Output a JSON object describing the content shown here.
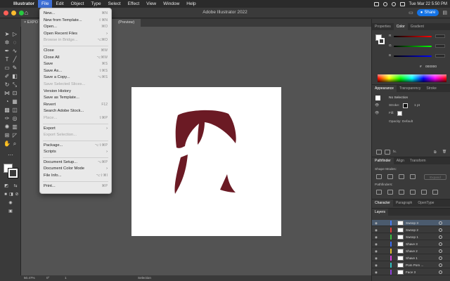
{
  "menubar": {
    "apple": "",
    "items": [
      "Illustrator",
      "File",
      "Edit",
      "Object",
      "Type",
      "Select",
      "Effect",
      "View",
      "Window",
      "Help"
    ],
    "active_index": 1,
    "clock": "Tue Mar 22  5:50 PM"
  },
  "titlebar": {
    "title": "Adobe Illustrator 2022",
    "share_label": "Share",
    "traffic_colors": [
      "#ff5f57",
      "#febc2e",
      "#28c840"
    ]
  },
  "doctab": {
    "label": "EXPO",
    "suffix": "(Preview)"
  },
  "file_menu": {
    "items": [
      {
        "label": "New...",
        "shortcut": "⌘N",
        "disabled": false,
        "submenu": false
      },
      {
        "label": "New from Template...",
        "shortcut": "⇧⌘N",
        "disabled": false,
        "submenu": false
      },
      {
        "label": "Open...",
        "shortcut": "⌘O",
        "disabled": false,
        "submenu": false
      },
      {
        "label": "Open Recent Files",
        "shortcut": "",
        "disabled": false,
        "submenu": true
      },
      {
        "label": "Browse in Bridge...",
        "shortcut": "⌥⌘O",
        "disabled": true,
        "submenu": false
      },
      {
        "sep": true
      },
      {
        "label": "Close",
        "shortcut": "⌘W",
        "disabled": false,
        "submenu": false
      },
      {
        "label": "Close All",
        "shortcut": "⌥⌘W",
        "disabled": false,
        "submenu": false
      },
      {
        "label": "Save",
        "shortcut": "⌘S",
        "disabled": false,
        "submenu": false
      },
      {
        "label": "Save As...",
        "shortcut": "⇧⌘S",
        "disabled": false,
        "submenu": false
      },
      {
        "label": "Save a Copy...",
        "shortcut": "⌥⌘S",
        "disabled": false,
        "submenu": false
      },
      {
        "label": "Save Selected Slices...",
        "shortcut": "",
        "disabled": true,
        "submenu": false
      },
      {
        "label": "Version History",
        "shortcut": "",
        "disabled": false,
        "submenu": false
      },
      {
        "label": "Save as Template...",
        "shortcut": "",
        "disabled": false,
        "submenu": false
      },
      {
        "label": "Revert",
        "shortcut": "F12",
        "disabled": false,
        "submenu": false
      },
      {
        "label": "Search Adobe Stock...",
        "shortcut": "",
        "disabled": false,
        "submenu": false
      },
      {
        "label": "Place...",
        "shortcut": "⇧⌘P",
        "disabled": true,
        "submenu": false
      },
      {
        "sep": true
      },
      {
        "label": "Export",
        "shortcut": "",
        "disabled": false,
        "submenu": true
      },
      {
        "label": "Export Selection...",
        "shortcut": "",
        "disabled": true,
        "submenu": false
      },
      {
        "sep": true
      },
      {
        "label": "Package...",
        "shortcut": "⌥⇧⌘P",
        "disabled": false,
        "submenu": false
      },
      {
        "label": "Scripts",
        "shortcut": "",
        "disabled": false,
        "submenu": true
      },
      {
        "sep": true
      },
      {
        "label": "Document Setup...",
        "shortcut": "⌥⌘P",
        "disabled": false,
        "submenu": false
      },
      {
        "label": "Document Color Mode",
        "shortcut": "",
        "disabled": false,
        "submenu": true
      },
      {
        "label": "File Info...",
        "shortcut": "⌥⇧⌘I",
        "disabled": false,
        "submenu": false
      },
      {
        "sep": true
      },
      {
        "label": "Print...",
        "shortcut": "⌘P",
        "disabled": false,
        "submenu": false
      }
    ]
  },
  "panels": {
    "top_tabs": [
      "Properties",
      "Color",
      "Gradient"
    ],
    "color_labels": {
      "r": "R",
      "g": "G",
      "b": "B"
    },
    "hex_value": "000000",
    "appearance_tabs": [
      "Appearance",
      "Transparency",
      "Stroke"
    ],
    "appearance": {
      "no_selection": "No Selection",
      "stroke_label": "Stroke:",
      "stroke_value": "1 pt",
      "fill_label": "Fill:",
      "opacity_label": "Opacity: Default"
    },
    "pathfinder_tabs": [
      "Pathfinder",
      "Align",
      "Transform"
    ],
    "shape_modes_label": "Shape Modes:",
    "expand_label": "Expand",
    "pathfinders_label": "Pathfinders:",
    "character_tabs": [
      "Character",
      "Paragraph",
      "OpenType"
    ],
    "layers_tab": "Layers",
    "layers": [
      {
        "name": "Swoop 3",
        "color": "#4a7df0",
        "selected": true
      },
      {
        "name": "Swoop 2",
        "color": "#e03c3c",
        "selected": false
      },
      {
        "name": "Swoop 1",
        "color": "#3cc040",
        "selected": false
      },
      {
        "name": "Shave 3",
        "color": "#3c6cf0",
        "selected": false
      },
      {
        "name": "Shave 2",
        "color": "#e0c030",
        "selected": false
      },
      {
        "name": "Shave 1",
        "color": "#e040e0",
        "selected": false
      },
      {
        "name": "Pom Pom ...",
        "color": "#30c0c0",
        "selected": false
      },
      {
        "name": "Face 3",
        "color": "#9040e0",
        "selected": false
      }
    ]
  },
  "status": {
    "zoom": "50.47%",
    "angle": "0°",
    "page": "1",
    "tool": "Selection"
  },
  "artwork": {
    "hair_color": "#6b1a24"
  }
}
